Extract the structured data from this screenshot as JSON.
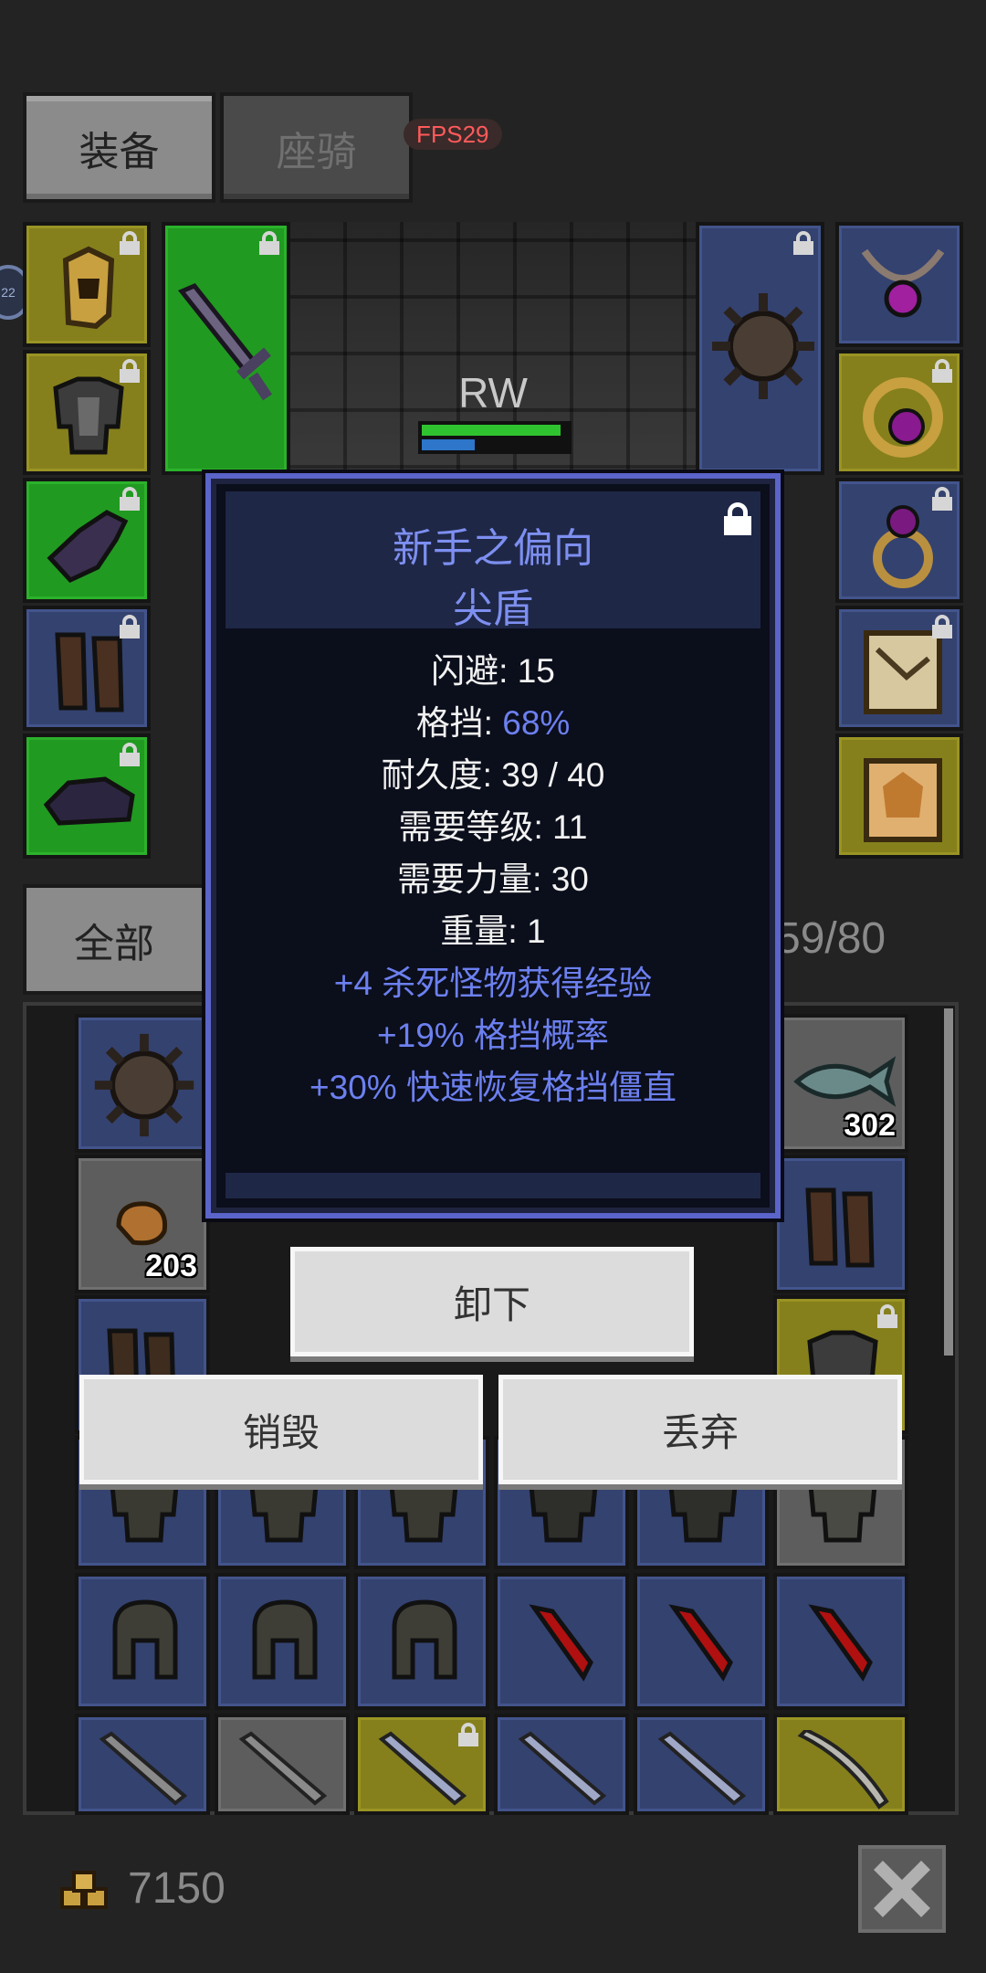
{
  "tabs": {
    "equipment": "装备",
    "mount": "座骑"
  },
  "fps": "FPS29",
  "side_badge": "22",
  "character": {
    "name": "RW",
    "hp_fraction": 0.95,
    "mp_fraction": 0.36
  },
  "inventory": {
    "filter": "全部",
    "capacity": "59/80",
    "counts": {
      "fish": "302",
      "meat": "203"
    }
  },
  "tooltip": {
    "name": "新手之偏向",
    "type": "尖盾",
    "stats": [
      {
        "label": "闪避: ",
        "value": "15"
      },
      {
        "label": "格挡: ",
        "value": "68%"
      },
      {
        "label": "耐久度: ",
        "value": "39 / 40"
      },
      {
        "label": "需要等级: ",
        "value": "11"
      },
      {
        "label": "需要力量: ",
        "value": "30"
      },
      {
        "label": "重量: ",
        "value": "1"
      }
    ],
    "affixes": [
      "+4 杀死怪物获得经验",
      "+19% 格挡概率",
      "+30% 快速恢复格挡僵直"
    ]
  },
  "actions": {
    "unequip": "卸下",
    "destroy": "销毁",
    "drop": "丢弃"
  },
  "gold": "7150",
  "colors": {
    "rarity_green": "#219a21",
    "rarity_yellow": "#85801c",
    "rarity_blue": "#344270",
    "tooltip_border": "#5b64c9",
    "affix_blue": "#6c80f0",
    "fps_red": "#ff5a5a"
  }
}
